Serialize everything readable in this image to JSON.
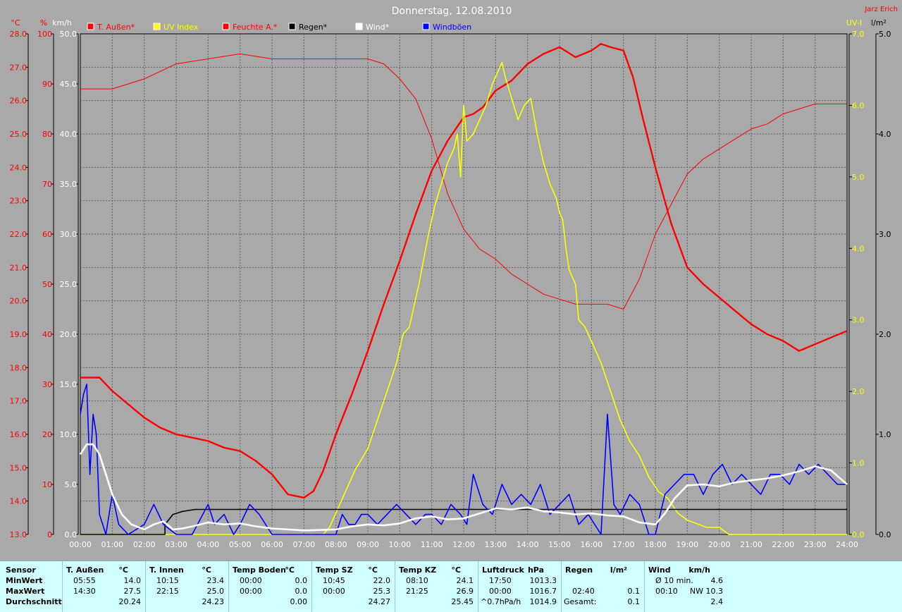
{
  "chart_data": {
    "type": "line",
    "title": "Donnerstag, 12.08.2010",
    "author": "Jarz Erich",
    "x_ticks": [
      "00:00",
      "01:00",
      "02:00",
      "03:00",
      "04:00",
      "05:00",
      "06:00",
      "07:00",
      "08:00",
      "09:00",
      "10:00",
      "11:00",
      "12:00",
      "13:00",
      "14:00",
      "15:00",
      "16:00",
      "17:00",
      "18:00",
      "19:00",
      "20:00",
      "21:00",
      "22:00",
      "23:00",
      "24:00"
    ],
    "axes": {
      "temp": {
        "label": "°C",
        "color": "#ff0000",
        "min": 13,
        "max": 28,
        "ticks": [
          "13.0",
          "14.0",
          "15.0",
          "16.0",
          "17.0",
          "18.0",
          "19.0",
          "20.0",
          "21.0",
          "22.0",
          "23.0",
          "24.0",
          "25.0",
          "26.0",
          "27.0",
          "28.0"
        ]
      },
      "humidity": {
        "label": "%",
        "color": "#ff0000",
        "min": 0,
        "max": 100,
        "ticks": [
          "0",
          "10",
          "20",
          "30",
          "40",
          "50",
          "60",
          "70",
          "80",
          "90",
          "100"
        ]
      },
      "wind": {
        "label": "km/h",
        "color": "#ffffff",
        "min": 0,
        "max": 50,
        "ticks": [
          "0.0",
          "5.0",
          "10.0",
          "15.0",
          "20.0",
          "25.0",
          "30.0",
          "35.0",
          "40.0",
          "45.0",
          "50.0"
        ]
      },
      "uv": {
        "label": "UV-I",
        "color": "#ffff00",
        "min": 0,
        "max": 7,
        "ticks": [
          "0.0",
          "1.0",
          "2.0",
          "3.0",
          "4.0",
          "5.0",
          "6.0",
          "7.0"
        ]
      },
      "rain": {
        "label": "l/m²",
        "color": "#000000",
        "min": 0,
        "max": 5,
        "ticks": [
          "0.0",
          "1.0",
          "2.0",
          "3.0",
          "4.0",
          "5.0"
        ]
      }
    },
    "legend": [
      {
        "label": "T. Außen*",
        "color": "#ff0000"
      },
      {
        "label": "UV Index",
        "color": "#ffff00"
      },
      {
        "label": "Feuchte A.*",
        "color": "#ff0000"
      },
      {
        "label": "Regen*",
        "color": "#000000"
      },
      {
        "label": "Wind*",
        "color": "#ffffff"
      },
      {
        "label": "Windböen",
        "color": "#0000ff"
      }
    ],
    "series": [
      {
        "name": "T. Außen*",
        "axis": "temp",
        "color": "#ff0000",
        "width": 2.4,
        "x": [
          0,
          0.6,
          1,
          1.5,
          2,
          2.5,
          3,
          3.5,
          4,
          4.5,
          5,
          5.5,
          6,
          6.5,
          7,
          7.3,
          7.6,
          8,
          8.5,
          9,
          9.5,
          10,
          10.5,
          11,
          11.5,
          12,
          12.3,
          12.6,
          13,
          13.5,
          14,
          14.5,
          15,
          15.5,
          16,
          16.3,
          16.6,
          17,
          17.3,
          17.6,
          18,
          18.5,
          19,
          19.5,
          20,
          20.5,
          21,
          21.5,
          22,
          22.5,
          23,
          23.5,
          24
        ],
        "y": [
          17.7,
          17.7,
          17.3,
          16.9,
          16.5,
          16.2,
          16.0,
          15.9,
          15.8,
          15.6,
          15.5,
          15.2,
          14.8,
          14.2,
          14.1,
          14.3,
          14.9,
          16.0,
          17.2,
          18.5,
          19.9,
          21.2,
          22.6,
          23.9,
          24.8,
          25.5,
          25.6,
          25.8,
          26.3,
          26.6,
          27.1,
          27.4,
          27.6,
          27.3,
          27.5,
          27.7,
          27.6,
          27.5,
          26.7,
          25.5,
          24.0,
          22.3,
          21.0,
          20.5,
          20.1,
          19.7,
          19.3,
          19.0,
          18.8,
          18.5,
          18.7,
          18.9,
          19.1
        ]
      },
      {
        "name": "Feuchte A.*",
        "axis": "humidity",
        "color": "#ff0000",
        "width": 1,
        "x": [
          0,
          0.6,
          1,
          1.5,
          2,
          3,
          4,
          5,
          6,
          7,
          8,
          9,
          9.5,
          10,
          10.5,
          11,
          11.5,
          12,
          12.5,
          13,
          13.5,
          14,
          14.5,
          15,
          15.5,
          16,
          16.5,
          17,
          17.5,
          18,
          18.5,
          19,
          19.5,
          20,
          20.5,
          21,
          21.5,
          22,
          22.5,
          23,
          23.5,
          24
        ],
        "y": [
          89,
          89,
          89,
          90,
          91,
          94,
          95,
          96,
          95,
          95,
          95,
          95,
          94,
          91,
          87,
          79,
          68,
          61,
          57,
          55,
          52,
          50,
          48,
          47,
          46,
          46,
          46,
          45,
          51,
          60,
          66,
          72,
          75,
          77,
          79,
          81,
          82,
          84,
          85,
          86,
          86,
          86
        ]
      },
      {
        "name": "UV Index",
        "axis": "uv",
        "color": "#ffff00",
        "width": 1.6,
        "x": [
          0,
          7.6,
          7.8,
          8,
          8.3,
          8.6,
          9,
          9.3,
          9.6,
          9.9,
          10.1,
          10.3,
          10.6,
          10.9,
          11.1,
          11.3,
          11.5,
          11.7,
          11.8,
          11.9,
          12,
          12.1,
          12.3,
          12.5,
          12.7,
          12.9,
          13.1,
          13.2,
          13.3,
          13.5,
          13.7,
          13.9,
          14.1,
          14.3,
          14.5,
          14.7,
          14.9,
          15,
          15.1,
          15.2,
          15.3,
          15.5,
          15.6,
          15.8,
          16,
          16.3,
          16.6,
          16.9,
          17.2,
          17.5,
          17.8,
          18.1,
          18.4,
          18.7,
          19,
          19.3,
          19.6,
          20,
          20.3,
          24
        ],
        "y": [
          0,
          0,
          0.1,
          0.3,
          0.6,
          0.9,
          1.2,
          1.6,
          2.0,
          2.4,
          2.8,
          2.9,
          3.5,
          4.2,
          4.6,
          4.9,
          5.2,
          5.4,
          5.6,
          5.0,
          6.0,
          5.5,
          5.6,
          5.8,
          6.0,
          6.3,
          6.5,
          6.6,
          6.4,
          6.1,
          5.8,
          6.0,
          6.1,
          5.6,
          5.2,
          4.9,
          4.7,
          4.5,
          4.4,
          4.0,
          3.7,
          3.5,
          3.0,
          2.9,
          2.7,
          2.4,
          2.0,
          1.6,
          1.3,
          1.1,
          0.8,
          0.6,
          0.5,
          0.3,
          0.2,
          0.15,
          0.1,
          0.1,
          0,
          0
        ]
      },
      {
        "name": "Regen*",
        "axis": "rain",
        "color": "#000000",
        "width": 1.6,
        "x": [
          0,
          2.65,
          2.65,
          2.9,
          3.2,
          3.6,
          4.2,
          24
        ],
        "y": [
          0,
          0,
          0.1,
          0.2,
          0.23,
          0.25,
          0.25,
          0.25
        ]
      },
      {
        "name": "Windböen",
        "axis": "wind",
        "color": "#0000ff",
        "width": 1.6,
        "x": [
          0,
          0.1,
          0.2,
          0.3,
          0.4,
          0.5,
          0.6,
          0.8,
          1,
          1.2,
          1.5,
          2,
          2.3,
          2.6,
          3,
          3.5,
          4,
          4.2,
          4.5,
          4.8,
          5,
          5.3,
          5.6,
          6,
          6.5,
          7,
          7.5,
          8,
          8.2,
          8.4,
          8.6,
          8.8,
          9,
          9.3,
          9.6,
          9.9,
          10.2,
          10.5,
          10.8,
          11,
          11.3,
          11.6,
          11.9,
          12.1,
          12.3,
          12.6,
          12.9,
          13.2,
          13.5,
          13.8,
          14.1,
          14.4,
          14.7,
          15,
          15.3,
          15.6,
          15.9,
          16.1,
          16.3,
          16.5,
          16.7,
          16.9,
          17.2,
          17.5,
          17.8,
          18,
          18.3,
          18.6,
          18.9,
          19.2,
          19.5,
          19.8,
          20.1,
          20.4,
          20.7,
          21,
          21.3,
          21.6,
          21.9,
          22.2,
          22.5,
          22.8,
          23.1,
          23.4,
          23.7,
          24
        ],
        "y": [
          12,
          14,
          15,
          6,
          12,
          10,
          2,
          0,
          4,
          1,
          0,
          1,
          3,
          1,
          0,
          0,
          3,
          1,
          2,
          0,
          1,
          3,
          2,
          0,
          0,
          0,
          0,
          0,
          2,
          1,
          1,
          2,
          2,
          1,
          2,
          3,
          2,
          1,
          2,
          2,
          1,
          3,
          2,
          1,
          6,
          3,
          2,
          5,
          3,
          4,
          3,
          5,
          2,
          3,
          4,
          1,
          2,
          1,
          0,
          12,
          3,
          2,
          4,
          3,
          0,
          0,
          4,
          5,
          6,
          6,
          4,
          6,
          7,
          5,
          6,
          5,
          4,
          6,
          6,
          5,
          7,
          6,
          7,
          6,
          5,
          5
        ]
      },
      {
        "name": "Wind*",
        "axis": "wind",
        "color": "#ffffff",
        "width": 2.6,
        "x": [
          0,
          0.2,
          0.4,
          0.6,
          0.8,
          1,
          1.3,
          1.6,
          2,
          2.3,
          2.6,
          2.9,
          3.2,
          3.5,
          4,
          4.5,
          5,
          5.5,
          6,
          7,
          8,
          8.5,
          9,
          9.5,
          10,
          10.5,
          11,
          11.5,
          12,
          12.5,
          13,
          13.5,
          14,
          14.5,
          15,
          15.5,
          16,
          16.5,
          17,
          17.5,
          18,
          18.3,
          18.6,
          19,
          19.5,
          20,
          20.5,
          21,
          21.5,
          22,
          22.5,
          23,
          23.5,
          24
        ],
        "y": [
          8,
          9,
          9,
          8,
          6,
          4,
          2,
          1,
          0.5,
          1,
          1.3,
          0.5,
          0.6,
          0.8,
          1.2,
          1,
          1.1,
          0.8,
          0.6,
          0.4,
          0.5,
          0.8,
          1.0,
          0.9,
          1.1,
          1.6,
          1.8,
          1.5,
          1.6,
          2.1,
          2.6,
          2.5,
          2.7,
          2.3,
          2.2,
          2.0,
          2.1,
          1.9,
          1.8,
          1.2,
          1.0,
          2.1,
          3.6,
          4.9,
          5.0,
          4.8,
          5.2,
          5.4,
          5.6,
          5.9,
          6.3,
          6.8,
          6.4,
          5.0
        ]
      }
    ]
  },
  "stats": {
    "row_labels": [
      "Sensor",
      "MinWert",
      "MaxWert",
      "Durchschnitt"
    ],
    "groups": [
      {
        "title": "T. Außen",
        "unit": "°C",
        "min": [
          "05:55",
          "14.0"
        ],
        "max": [
          "14:30",
          "27.5"
        ],
        "avg": [
          "",
          "20.24"
        ]
      },
      {
        "title": "T. Innen",
        "unit": "°C",
        "min": [
          "10:15",
          "23.4"
        ],
        "max": [
          "22:15",
          "25.0"
        ],
        "avg": [
          "",
          "24.23"
        ]
      },
      {
        "title": "Temp Boden",
        "unit": "°C",
        "min": [
          "00:00",
          "0.0"
        ],
        "max": [
          "00:00",
          "0.0"
        ],
        "avg": [
          "",
          "0.00"
        ]
      },
      {
        "title": "Temp SZ",
        "unit": "°C",
        "min": [
          "10:45",
          "22.0"
        ],
        "max": [
          "00:00",
          "25.3"
        ],
        "avg": [
          "",
          "24.27"
        ]
      },
      {
        "title": "Temp KZ",
        "unit": "°C",
        "min": [
          "08:10",
          "24.1"
        ],
        "max": [
          "21:25",
          "26.9"
        ],
        "avg": [
          "",
          "25.45"
        ]
      },
      {
        "title": "Luftdruck",
        "unit": "hPa",
        "min": [
          "17:50",
          "1013.3"
        ],
        "max": [
          "00:00",
          "1016.7"
        ],
        "avg": [
          "^0.7hPa/h",
          "1014.9"
        ]
      },
      {
        "title": "Regen",
        "unit": "l/m²",
        "min": [
          "",
          ""
        ],
        "max": [
          "02:40",
          "0.1"
        ],
        "avg": [
          "Gesamt:",
          "0.1"
        ]
      },
      {
        "title": "Wind",
        "unit": "km/h",
        "min": [
          "Ø 10 min.",
          "4.6"
        ],
        "max": [
          "00:10",
          "NW 10.3"
        ],
        "avg": [
          "",
          "2.4"
        ]
      }
    ]
  }
}
